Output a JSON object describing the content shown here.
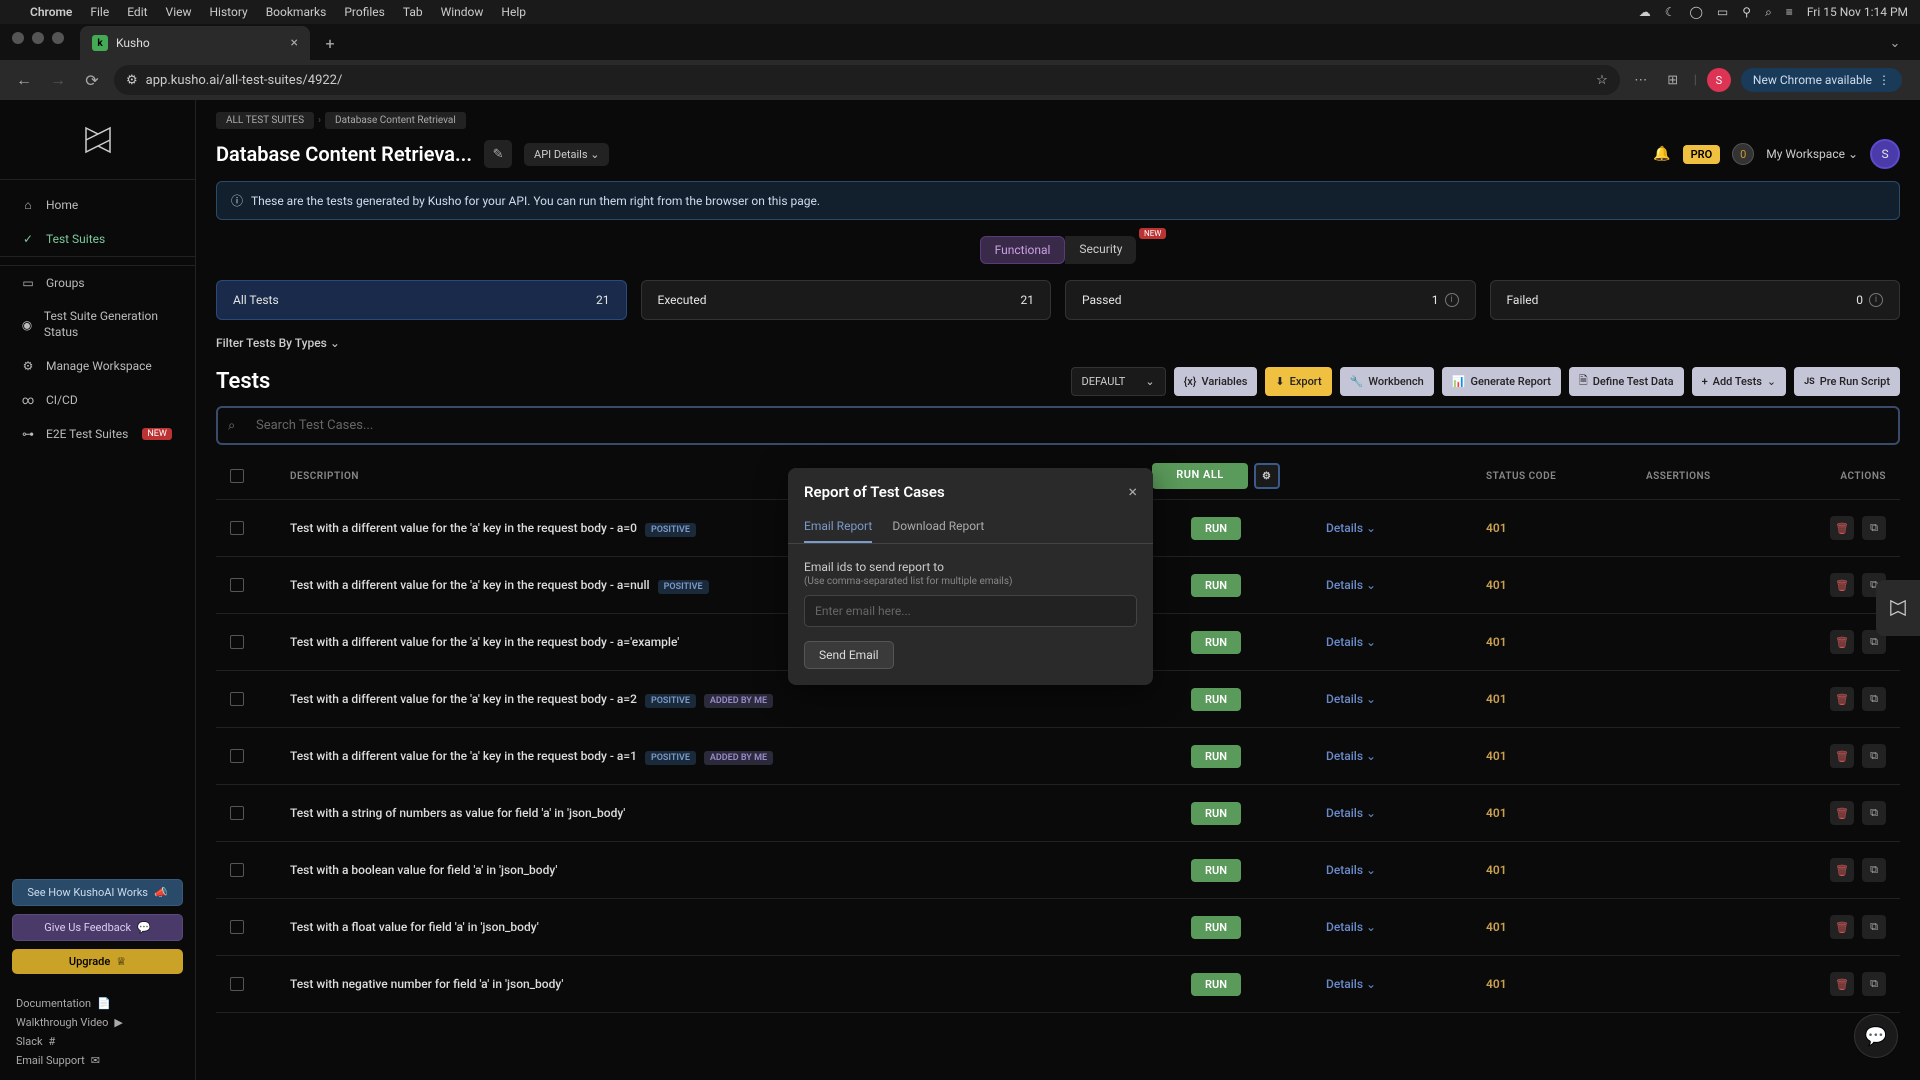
{
  "macos": {
    "app": "Chrome",
    "menus": [
      "File",
      "Edit",
      "View",
      "History",
      "Bookmarks",
      "Profiles",
      "Tab",
      "Window",
      "Help"
    ],
    "clock": "Fri 15 Nov  1:14 PM"
  },
  "chrome": {
    "tab_title": "Kusho",
    "url": "app.kusho.ai/all-test-suites/4922/",
    "update_label": "New Chrome available",
    "profile_initial": "S"
  },
  "sidebar": {
    "items": [
      {
        "label": "Home"
      },
      {
        "label": "Test Suites",
        "active": true
      },
      {
        "label": "Groups"
      },
      {
        "label": "Test Suite Generation Status"
      },
      {
        "label": "Manage Workspace"
      },
      {
        "label": "CI/CD"
      },
      {
        "label": "E2E Test Suites",
        "badge": "NEW"
      }
    ],
    "promo_works": "See How KushoAI Works",
    "promo_feedback": "Give Us Feedback",
    "promo_upgrade": "Upgrade",
    "footer": [
      "Documentation",
      "Walkthrough Video",
      "Slack",
      "Email Support"
    ]
  },
  "breadcrumb": {
    "root": "ALL TEST SUITES",
    "current": "Database Content Retrieval"
  },
  "page": {
    "title": "Database Content Retrieva...",
    "api_details": "API Details",
    "pro": "PRO",
    "workspace": "My Workspace",
    "avatar": "S",
    "count": "0",
    "info_banner": "These are the tests generated by Kusho for your API. You can run them right from the browser on this page."
  },
  "tabs": {
    "functional": "Functional",
    "security": "Security",
    "new": "NEW"
  },
  "stats": [
    {
      "label": "All Tests",
      "value": "21",
      "active": true
    },
    {
      "label": "Executed",
      "value": "21"
    },
    {
      "label": "Passed",
      "value": "1",
      "info": true
    },
    {
      "label": "Failed",
      "value": "0",
      "info": true
    }
  ],
  "filter": "Filter Tests By Types",
  "tests_title": "Tests",
  "toolbar": {
    "default": "DEFAULT",
    "variables": "Variables",
    "export": "Export",
    "workbench": "Workbench",
    "generate": "Generate Report",
    "define": "Define Test Data",
    "add": "Add Tests",
    "pre": "Pre Run Script"
  },
  "search_placeholder": "Search Test Cases...",
  "columns": {
    "desc": "DESCRIPTION",
    "runall": "RUN ALL",
    "status": "STATUS CODE",
    "assert": "ASSERTIONS",
    "actions": "ACTIONS"
  },
  "rows": [
    {
      "desc": "Test with a different value for the 'a' key in the request body - a=0",
      "tags": [
        "POSITIVE"
      ],
      "status": "401"
    },
    {
      "desc": "Test with a different value for the 'a' key in the request body - a=null",
      "tags": [
        "POSITIVE"
      ],
      "status": "401"
    },
    {
      "desc": "Test with a different value for the 'a' key in the request body - a='example'",
      "tags": [],
      "status": "401"
    },
    {
      "desc": "Test with a different value for the 'a' key in the request body - a=2",
      "tags": [
        "POSITIVE",
        "ADDED BY ME"
      ],
      "status": "401"
    },
    {
      "desc": "Test with a different value for the 'a' key in the request body - a=1",
      "tags": [
        "POSITIVE",
        "ADDED BY ME"
      ],
      "status": "401"
    },
    {
      "desc": "Test with a string of numbers as value for field 'a' in 'json_body'",
      "tags": [],
      "status": "401"
    },
    {
      "desc": "Test with a boolean value for field 'a' in 'json_body'",
      "tags": [],
      "status": "401"
    },
    {
      "desc": "Test with a float value for field 'a' in 'json_body'",
      "tags": [],
      "status": "401"
    },
    {
      "desc": "Test with negative number for field 'a' in 'json_body'",
      "tags": [],
      "status": "401"
    }
  ],
  "row_run": "RUN",
  "row_details": "Details",
  "modal": {
    "title": "Report of Test Cases",
    "tab_email": "Email Report",
    "tab_download": "Download Report",
    "field_label": "Email ids to send report to",
    "field_hint": "(Use comma-separated list for multiple emails)",
    "placeholder": "Enter email here...",
    "send": "Send Email"
  }
}
